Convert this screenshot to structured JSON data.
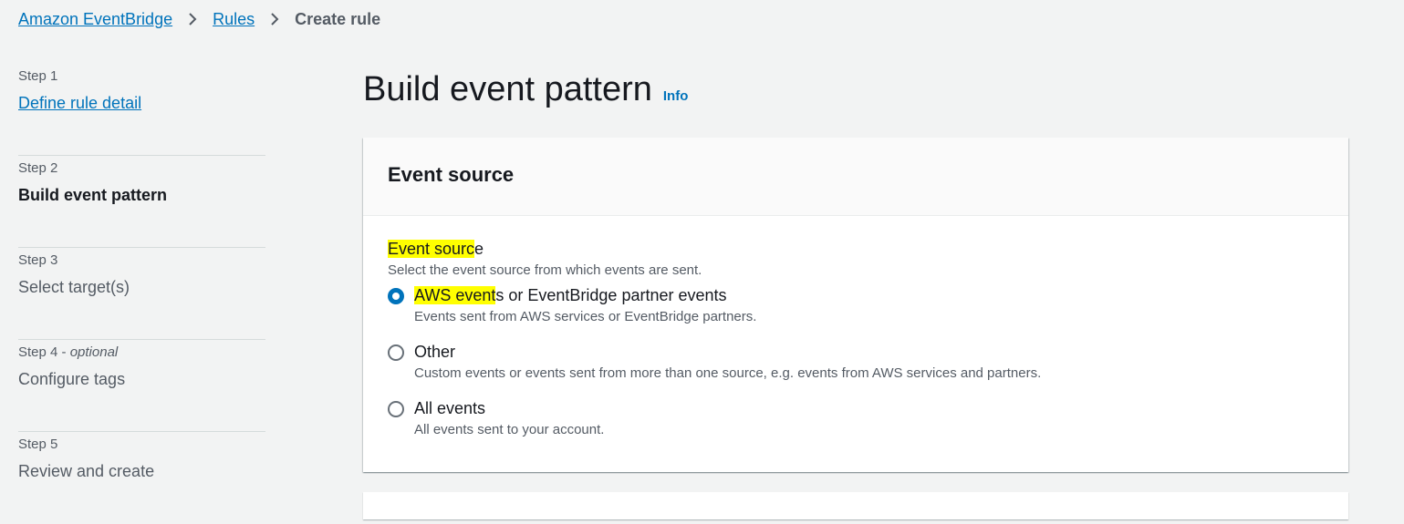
{
  "breadcrumb": {
    "items": [
      {
        "label": "Amazon EventBridge"
      },
      {
        "label": "Rules"
      }
    ],
    "current": "Create rule"
  },
  "steps": [
    {
      "num": "Step 1",
      "optional": "",
      "title": "Define rule detail"
    },
    {
      "num": "Step 2",
      "optional": "",
      "title": "Build event pattern"
    },
    {
      "num": "Step 3",
      "optional": "",
      "title": "Select target(s)"
    },
    {
      "num": "Step 4 - ",
      "optional": "optional",
      "title": "Configure tags"
    },
    {
      "num": "Step 5",
      "optional": "",
      "title": "Review and create"
    }
  ],
  "page": {
    "title": "Build event pattern",
    "info": "Info"
  },
  "event_source": {
    "header": "Event source",
    "label_highlight": "Event sourc",
    "label_rest": "e",
    "description": "Select the event source from which events are sent.",
    "options": [
      {
        "label_highlight": "AWS event",
        "label_rest": "s or EventBridge partner events",
        "description": "Events sent from AWS services or EventBridge partners.",
        "selected": true
      },
      {
        "label": "Other",
        "description": "Custom events or events sent from more than one source, e.g. events from AWS services and partners.",
        "selected": false
      },
      {
        "label": "All events",
        "description": "All events sent to your account.",
        "selected": false
      }
    ]
  },
  "colors": {
    "link": "#0073bb",
    "highlight": "#ffff00",
    "background": "#f2f3f3"
  }
}
